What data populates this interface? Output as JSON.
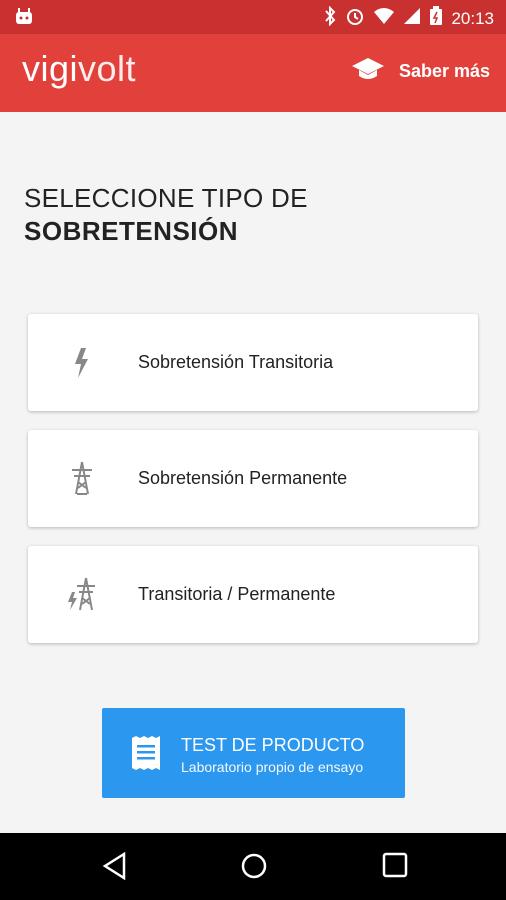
{
  "status": {
    "time": "20:13"
  },
  "app": {
    "logo_part1": "vigi",
    "logo_part2": "volt",
    "saber_label": "Saber más"
  },
  "title": {
    "line1": "SELECCIONE TIPO DE",
    "line2": "SOBRETENSIÓN"
  },
  "options": [
    {
      "label": "Sobretensión Transitoria",
      "icon": "lightning-bolt-icon"
    },
    {
      "label": "Sobretensión Permanente",
      "icon": "power-tower-icon"
    },
    {
      "label": "Transitoria / Permanente",
      "icon": "tower-lightning-icon"
    }
  ],
  "cta": {
    "title": "TEST DE PRODUCTO",
    "subtitle": "Laboratorio propio de ensayo",
    "icon": "receipt-icon"
  },
  "colors": {
    "statusbar": "#c8312f",
    "appbar": "#e2403b",
    "cta": "#2c97ee"
  }
}
